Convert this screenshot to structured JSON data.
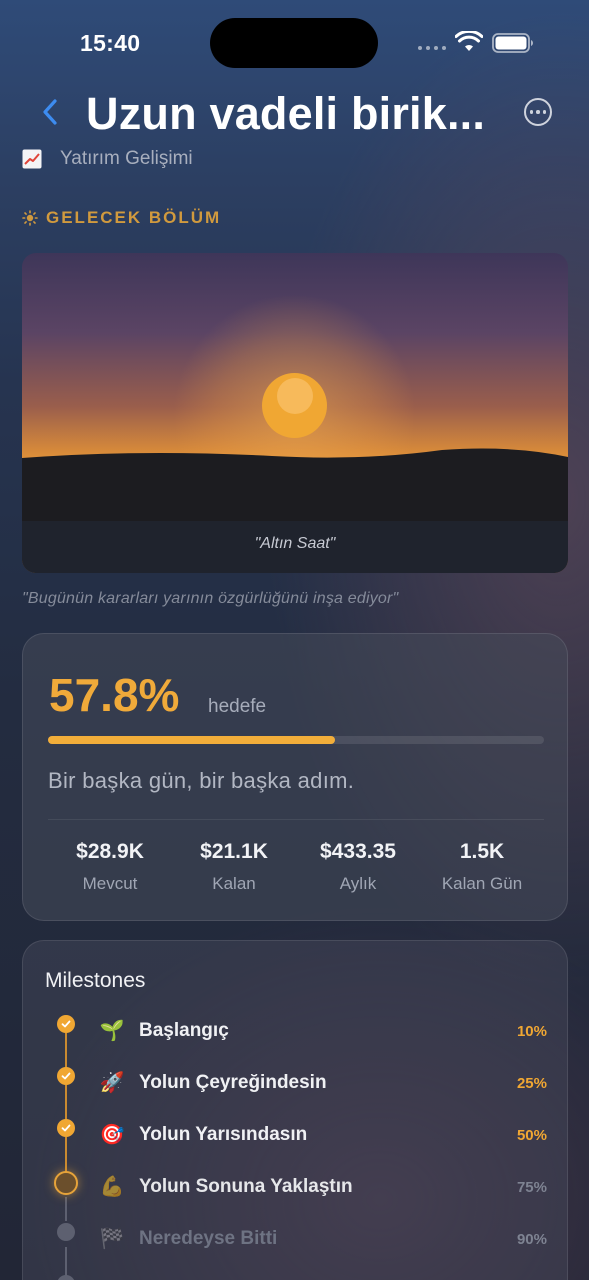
{
  "status_bar": {
    "time": "15:40"
  },
  "header": {
    "title": "Uzun vadeli birik...",
    "subtitle": "Yatırım Gelişimi"
  },
  "section": {
    "label": "GELECEK BÖLÜM"
  },
  "scene": {
    "caption": "\"Altın Saat\""
  },
  "quote": "\"Bugünün kararları yarının özgürlüğünü inşa ediyor\"",
  "progress": {
    "percent_text": "57.8%",
    "percent_value": 57.8,
    "label": "hedefe",
    "motto": "Bir başka gün, bir başka adım.",
    "stats": [
      {
        "value": "$28.9K",
        "label": "Mevcut"
      },
      {
        "value": "$21.1K",
        "label": "Kalan"
      },
      {
        "value": "$433.35",
        "label": "Aylık"
      },
      {
        "value": "1.5K",
        "label": "Kalan Gün"
      }
    ]
  },
  "milestones": {
    "title": "Milestones",
    "items": [
      {
        "icon": "🌱",
        "icon_name": "seedling-icon",
        "label": "Başlangıç",
        "pct": "10%",
        "state": "done"
      },
      {
        "icon": "🚀",
        "icon_name": "rocket-icon",
        "label": "Yolun Çeyreğindesin",
        "pct": "25%",
        "state": "done"
      },
      {
        "icon": "🎯",
        "icon_name": "target-icon",
        "label": "Yolun Yarısındasın",
        "pct": "50%",
        "state": "done"
      },
      {
        "icon": "💪",
        "icon_name": "flexed-arm-icon",
        "label": "Yolun Sonuna Yaklaştın",
        "pct": "75%",
        "state": "current"
      },
      {
        "icon": "🏁",
        "icon_name": "checkered-flag-icon",
        "label": "Neredeyse Bitti",
        "pct": "90%",
        "state": "future"
      }
    ]
  },
  "colors": {
    "accent": "#f0a733",
    "background": "#232c40",
    "card": "#3a3e4e",
    "muted": "#a6acba"
  }
}
